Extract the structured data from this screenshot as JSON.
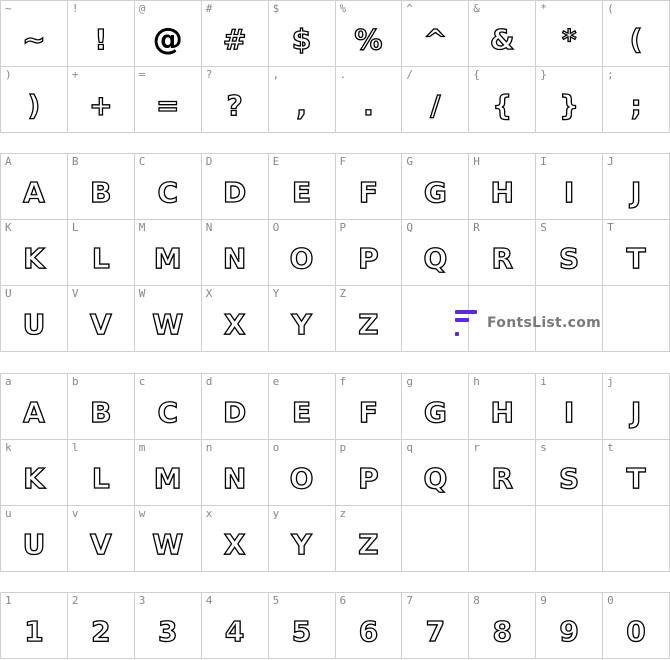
{
  "sections": [
    {
      "id": "symbols",
      "rows": [
        [
          {
            "key": "~",
            "glyph": "~"
          },
          {
            "key": "!",
            "glyph": "!"
          },
          {
            "key": "@",
            "glyph": "@",
            "solid": true
          },
          {
            "key": "#",
            "glyph": "#"
          },
          {
            "key": "$",
            "glyph": "$"
          },
          {
            "key": "%",
            "glyph": "%"
          },
          {
            "key": "^",
            "glyph": "^"
          },
          {
            "key": "&",
            "glyph": "&"
          },
          {
            "key": "*",
            "glyph": "*"
          },
          {
            "key": "(",
            "glyph": "("
          }
        ],
        [
          {
            "key": ")",
            "glyph": ")"
          },
          {
            "key": "+",
            "glyph": "+"
          },
          {
            "key": "=",
            "glyph": "="
          },
          {
            "key": "?",
            "glyph": "?"
          },
          {
            "key": ",",
            "glyph": ","
          },
          {
            "key": ".",
            "glyph": "."
          },
          {
            "key": "/",
            "glyph": "/"
          },
          {
            "key": "{",
            "glyph": "{"
          },
          {
            "key": "}",
            "glyph": "}"
          },
          {
            "key": ";",
            "glyph": ";"
          }
        ]
      ]
    },
    {
      "id": "uppercase",
      "rows": [
        [
          {
            "key": "A",
            "glyph": "A"
          },
          {
            "key": "B",
            "glyph": "B"
          },
          {
            "key": "C",
            "glyph": "C"
          },
          {
            "key": "D",
            "glyph": "D"
          },
          {
            "key": "E",
            "glyph": "E"
          },
          {
            "key": "F",
            "glyph": "F"
          },
          {
            "key": "G",
            "glyph": "G"
          },
          {
            "key": "H",
            "glyph": "H"
          },
          {
            "key": "I",
            "glyph": "I"
          },
          {
            "key": "J",
            "glyph": "J"
          }
        ],
        [
          {
            "key": "K",
            "glyph": "K"
          },
          {
            "key": "L",
            "glyph": "L"
          },
          {
            "key": "M",
            "glyph": "M"
          },
          {
            "key": "N",
            "glyph": "N"
          },
          {
            "key": "O",
            "glyph": "O"
          },
          {
            "key": "P",
            "glyph": "P"
          },
          {
            "key": "Q",
            "glyph": "Q"
          },
          {
            "key": "R",
            "glyph": "R"
          },
          {
            "key": "S",
            "glyph": "S"
          },
          {
            "key": "T",
            "glyph": "T"
          }
        ],
        [
          {
            "key": "U",
            "glyph": "U"
          },
          {
            "key": "V",
            "glyph": "V"
          },
          {
            "key": "W",
            "glyph": "W"
          },
          {
            "key": "X",
            "glyph": "X"
          },
          {
            "key": "Y",
            "glyph": "Y"
          },
          {
            "key": "Z",
            "glyph": "Z"
          },
          {
            "key": "",
            "glyph": ""
          },
          {
            "key": "",
            "glyph": ""
          },
          {
            "key": "",
            "glyph": ""
          },
          {
            "key": "",
            "glyph": ""
          }
        ]
      ]
    },
    {
      "id": "lowercase",
      "rows": [
        [
          {
            "key": "a",
            "glyph": "A"
          },
          {
            "key": "b",
            "glyph": "B"
          },
          {
            "key": "c",
            "glyph": "C"
          },
          {
            "key": "d",
            "glyph": "D"
          },
          {
            "key": "e",
            "glyph": "E"
          },
          {
            "key": "f",
            "glyph": "F"
          },
          {
            "key": "g",
            "glyph": "G"
          },
          {
            "key": "h",
            "glyph": "H"
          },
          {
            "key": "i",
            "glyph": "I"
          },
          {
            "key": "j",
            "glyph": "J"
          }
        ],
        [
          {
            "key": "k",
            "glyph": "K"
          },
          {
            "key": "l",
            "glyph": "L"
          },
          {
            "key": "m",
            "glyph": "M"
          },
          {
            "key": "n",
            "glyph": "N"
          },
          {
            "key": "o",
            "glyph": "O"
          },
          {
            "key": "p",
            "glyph": "P"
          },
          {
            "key": "q",
            "glyph": "Q"
          },
          {
            "key": "r",
            "glyph": "R"
          },
          {
            "key": "s",
            "glyph": "S"
          },
          {
            "key": "t",
            "glyph": "T"
          }
        ],
        [
          {
            "key": "u",
            "glyph": "U"
          },
          {
            "key": "v",
            "glyph": "V"
          },
          {
            "key": "w",
            "glyph": "W"
          },
          {
            "key": "x",
            "glyph": "X"
          },
          {
            "key": "y",
            "glyph": "Y"
          },
          {
            "key": "z",
            "glyph": "Z"
          },
          {
            "key": "",
            "glyph": ""
          },
          {
            "key": "",
            "glyph": ""
          },
          {
            "key": "",
            "glyph": ""
          },
          {
            "key": "",
            "glyph": ""
          }
        ]
      ]
    },
    {
      "id": "digits",
      "rows": [
        [
          {
            "key": "1",
            "glyph": "1"
          },
          {
            "key": "2",
            "glyph": "2"
          },
          {
            "key": "3",
            "glyph": "3"
          },
          {
            "key": "4",
            "glyph": "4"
          },
          {
            "key": "5",
            "glyph": "5"
          },
          {
            "key": "6",
            "glyph": "6"
          },
          {
            "key": "7",
            "glyph": "7"
          },
          {
            "key": "8",
            "glyph": "8"
          },
          {
            "key": "9",
            "glyph": "9"
          },
          {
            "key": "0",
            "glyph": "0"
          }
        ]
      ]
    }
  ],
  "watermark": {
    "text": "FontsList.com",
    "color": "#5b2bd6"
  }
}
